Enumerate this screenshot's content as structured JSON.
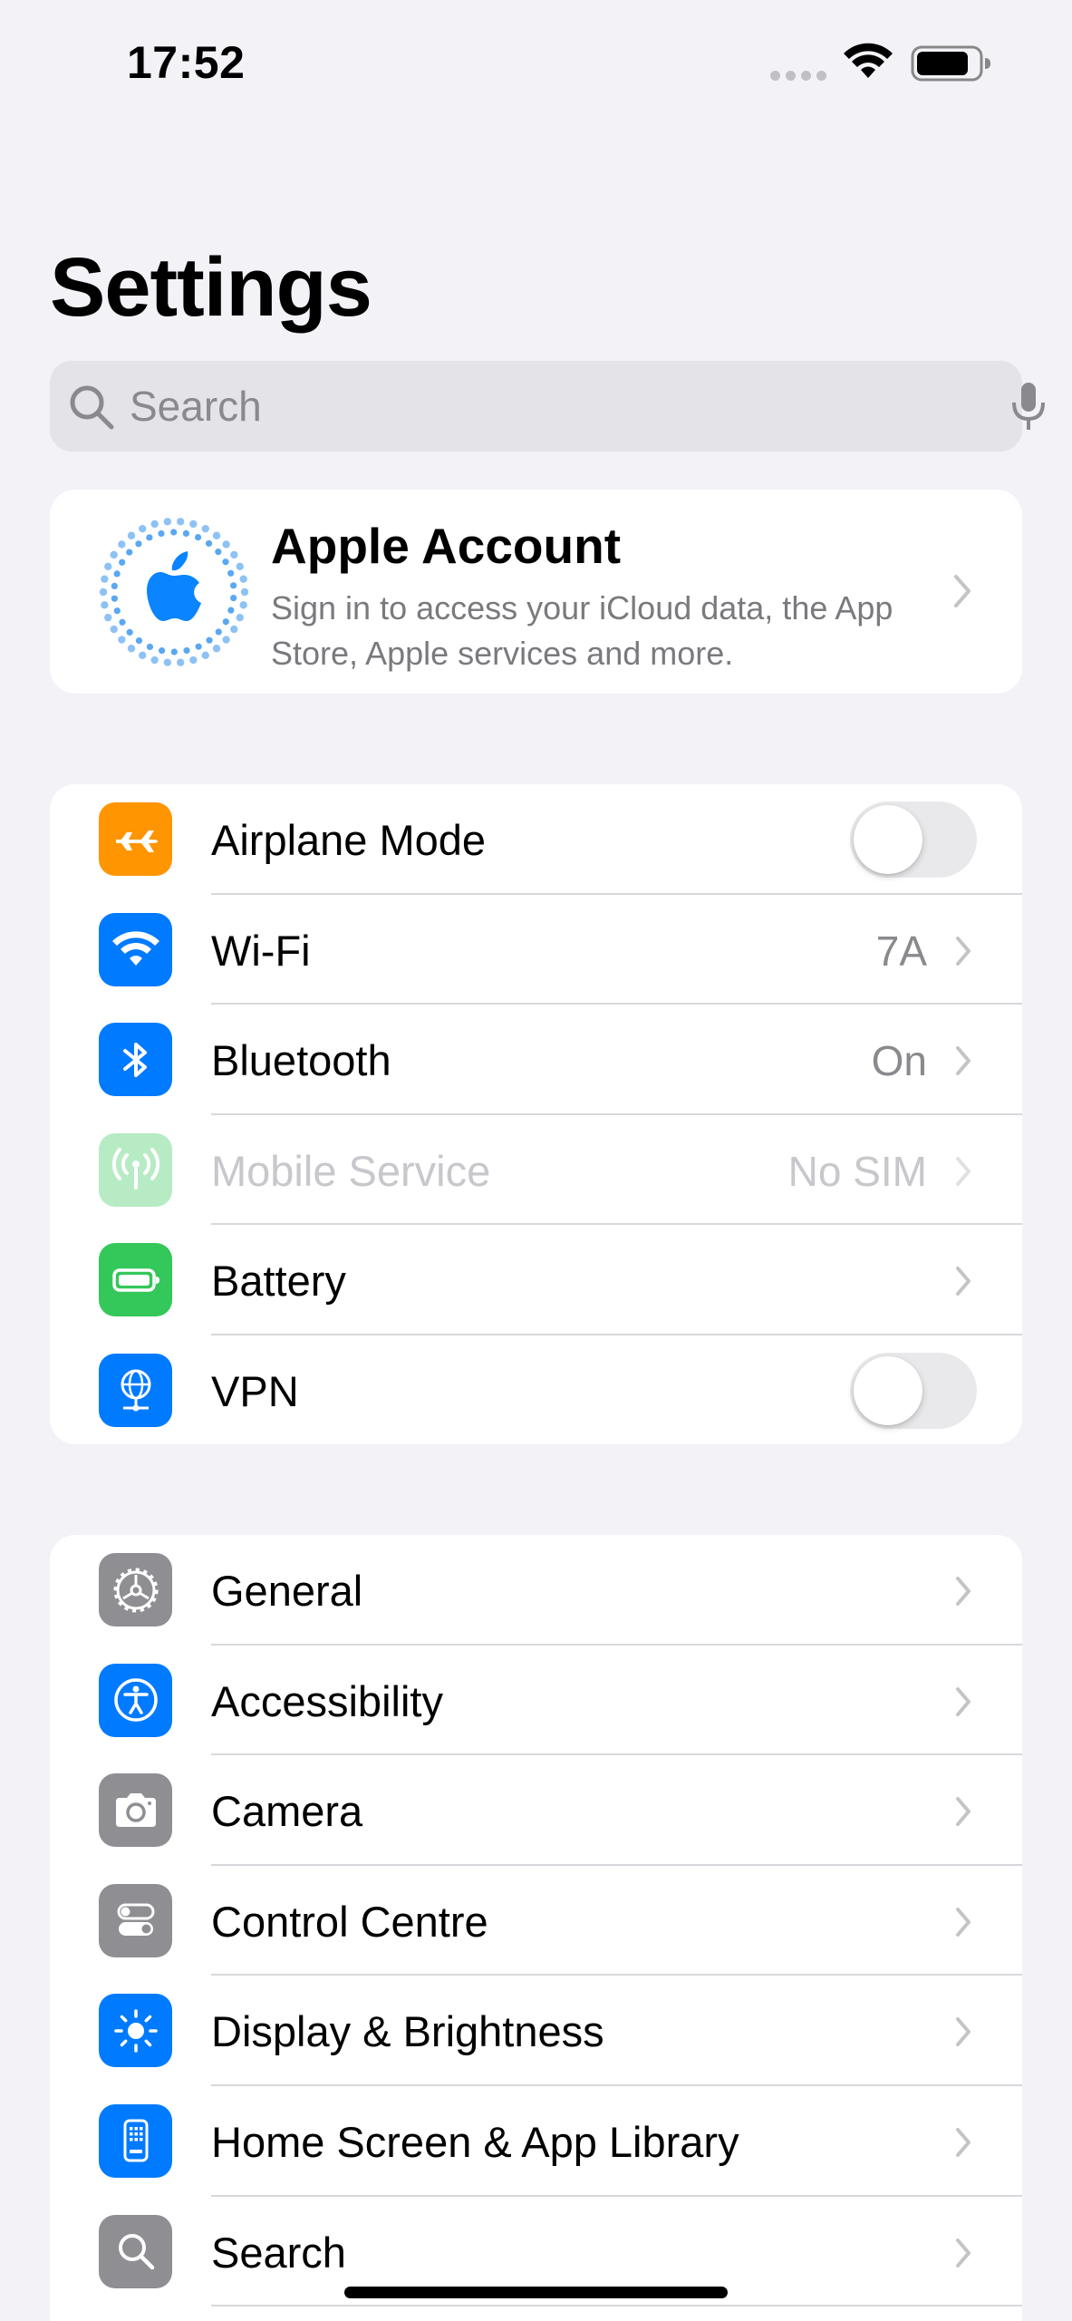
{
  "status_bar": {
    "time": "17:52"
  },
  "title": "Settings",
  "search": {
    "placeholder": "Search"
  },
  "account": {
    "title": "Apple Account",
    "subtitle": "Sign in to access your iCloud data, the App Store, Apple services and more."
  },
  "group1": [
    {
      "label": "Airplane Mode",
      "type": "toggle",
      "on": false,
      "icon": "airplane-icon",
      "color": "#ff9500"
    },
    {
      "label": "Wi-Fi",
      "value": "7A",
      "type": "nav",
      "icon": "wifi-icon",
      "color": "#007aff"
    },
    {
      "label": "Bluetooth",
      "value": "On",
      "type": "nav",
      "icon": "bluetooth-icon",
      "color": "#007aff"
    },
    {
      "label": "Mobile Service",
      "value": "No SIM",
      "type": "nav",
      "disabled": true,
      "icon": "antenna-icon",
      "color": "#34c759"
    },
    {
      "label": "Battery",
      "type": "nav",
      "icon": "battery-icon",
      "color": "#34c759"
    },
    {
      "label": "VPN",
      "type": "toggle",
      "on": false,
      "icon": "globe-icon",
      "color": "#007aff"
    }
  ],
  "group2": [
    {
      "label": "General",
      "icon": "gear-icon",
      "color": "#8e8e93"
    },
    {
      "label": "Accessibility",
      "icon": "accessibility-icon",
      "color": "#007aff"
    },
    {
      "label": "Camera",
      "icon": "camera-icon",
      "color": "#8e8e93"
    },
    {
      "label": "Control Centre",
      "icon": "switches-icon",
      "color": "#8e8e93"
    },
    {
      "label": "Display & Brightness",
      "icon": "sun-icon",
      "color": "#007aff"
    },
    {
      "label": "Home Screen & App Library",
      "icon": "phone-grid-icon",
      "color": "#007aff"
    },
    {
      "label": "Search",
      "icon": "magnifier-icon",
      "color": "#8e8e93"
    }
  ]
}
